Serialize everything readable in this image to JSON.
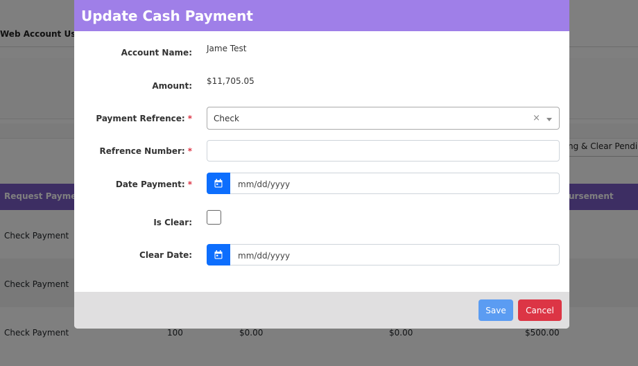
{
  "background": {
    "tab_label": "Web Account Users",
    "right_button_label": "ng & Clear Pending",
    "table": {
      "header_left": "Request Payment",
      "header_right": "ursement",
      "rows": [
        {
          "type": "Check Payment",
          "qty": "",
          "amount1": "",
          "amount2": "",
          "amount3": ""
        },
        {
          "type": "Check Payment",
          "qty": "",
          "amount1": "",
          "amount2": "",
          "amount3": ""
        },
        {
          "type": "Check Payment",
          "qty": "100",
          "amount1": "$0.00",
          "amount2": "$0.00",
          "amount3": "$500.00"
        }
      ]
    }
  },
  "modal": {
    "title": "Update Cash Payment",
    "fields": {
      "account_name": {
        "label": "Account Name:",
        "value": "Jame Test"
      },
      "amount": {
        "label": "Amount:",
        "value": "$11,705.05"
      },
      "payment_reference": {
        "label": "Payment Refrence:",
        "required_mark": "*",
        "value": "Check",
        "clear_symbol": "×"
      },
      "reference_number": {
        "label": "Refrence Number:",
        "required_mark": "*",
        "value": ""
      },
      "date_payment": {
        "label": "Date Payment:",
        "required_mark": "*",
        "placeholder": "mm/dd/yyyy"
      },
      "is_clear": {
        "label": "Is Clear:",
        "checked": false
      },
      "clear_date": {
        "label": "Clear Date:",
        "placeholder": "mm/dd/yyyy"
      }
    },
    "buttons": {
      "save": "Save",
      "cancel": "Cancel"
    },
    "colors": {
      "header": "#9f7fe8",
      "calendar_button": "#0d6efd",
      "save_button": "#5b9cf2",
      "cancel_button": "#dc3545",
      "required_mark": "#dc3545"
    }
  }
}
